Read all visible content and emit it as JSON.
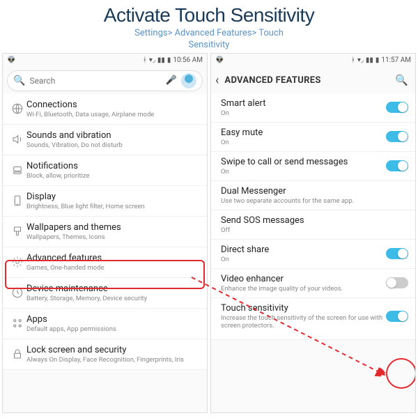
{
  "header": {
    "title": "Activate Touch Sensitivity",
    "breadcrumb_line1": "Settings> Advanced Features> Touch",
    "breadcrumb_line2": "Sensitivity"
  },
  "left": {
    "statusbar": {
      "time": "10:56 AM"
    },
    "search": {
      "placeholder": "Search"
    },
    "items": [
      {
        "title": "Connections",
        "sub": "Wi-Fi, Bluetooth, Data usage, Airplane mode"
      },
      {
        "title": "Sounds and vibration",
        "sub": "Sounds, Vibration, Do not disturb"
      },
      {
        "title": "Notifications",
        "sub": "Block, allow, prioritize"
      },
      {
        "title": "Display",
        "sub": "Brightness, Blue light filter, Home screen"
      },
      {
        "title": "Wallpapers and themes",
        "sub": "Wallpapers, Themes, Icons"
      },
      {
        "title": "Advanced features",
        "sub": "Games, One-handed mode"
      },
      {
        "title": "Device maintenance",
        "sub": "Battery, Storage, Memory, Device security"
      },
      {
        "title": "Apps",
        "sub": "Default apps, App permissions"
      },
      {
        "title": "Lock screen and security",
        "sub": "Always On Display, Face Recognition, Fingerprints, Iris"
      }
    ]
  },
  "right": {
    "statusbar": {
      "time": "11:57 AM"
    },
    "header": {
      "title": "ADVANCED FEATURES"
    },
    "items": [
      {
        "title": "Smart alert",
        "sub": "On",
        "toggle": "on"
      },
      {
        "title": "Easy mute",
        "sub": "On",
        "toggle": "on"
      },
      {
        "title": "Swipe to call or send messages",
        "sub": "On",
        "toggle": "on"
      },
      {
        "title": "Dual Messenger",
        "sub": "Use two separate accounts for the same app."
      },
      {
        "title": "Send SOS messages",
        "sub": "Off"
      },
      {
        "title": "Direct share",
        "sub": "On",
        "toggle": "on"
      },
      {
        "title": "Video enhancer",
        "sub": "Enhance the image quality of your videos.",
        "toggle": "off"
      },
      {
        "title": "Touch sensitivity",
        "sub": "Increase the touch sensitivity of the screen for use with screen protectors.",
        "toggle": "on"
      }
    ]
  }
}
